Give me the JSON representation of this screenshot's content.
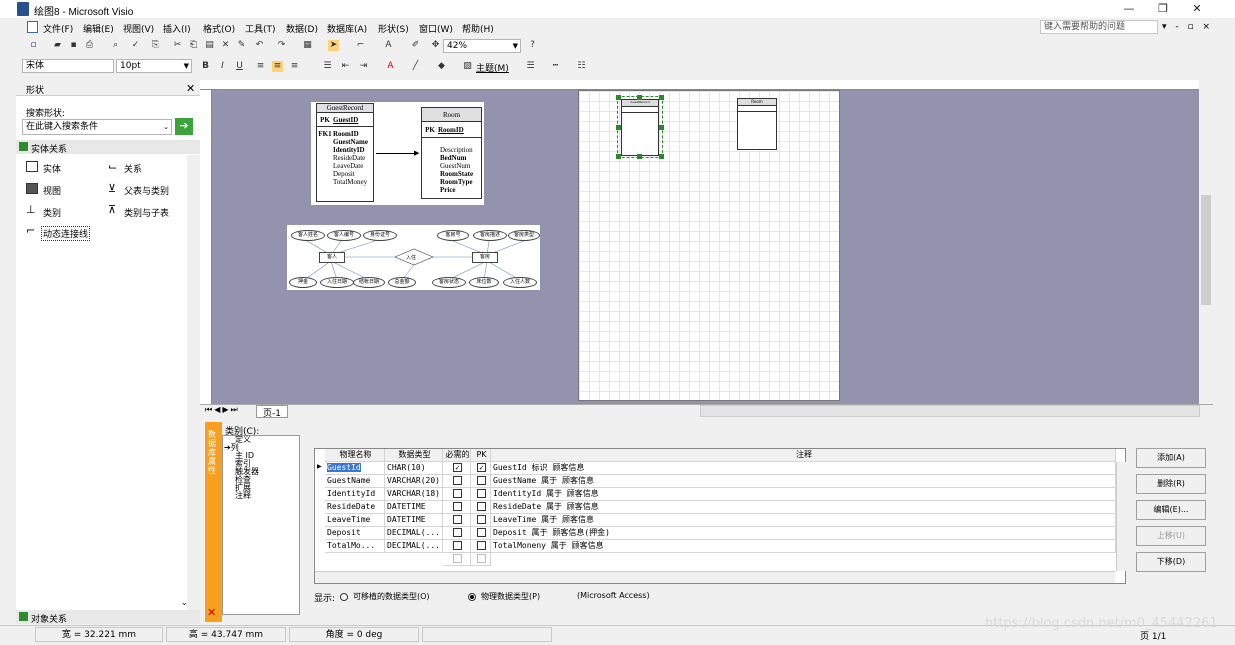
{
  "window": {
    "title": "绘图8 - Microsoft Visio",
    "minimize": "—",
    "restore": "❐",
    "close": "✕"
  },
  "menu": {
    "items": [
      "文件(F)",
      "编辑(E)",
      "视图(V)",
      "插入(I)",
      "格式(O)",
      "工具(T)",
      "数据(D)",
      "数据库(A)",
      "形状(S)",
      "窗口(W)",
      "帮助(H)"
    ],
    "help_placeholder": "键入需要帮助的问题",
    "doc_controls": "▾ - ▫ ×"
  },
  "toolbar": {
    "zoom": "42%",
    "font": "宋体",
    "size": "10pt",
    "theme": "主题(M)"
  },
  "shapes_pane": {
    "title": "形状",
    "search_label": "搜索形状:",
    "search_placeholder": "在此键入搜索条件",
    "stencil_entity": "实体关系",
    "stencil_object": "对象关系",
    "items": [
      {
        "label": "实体",
        "icon": "entity-icon"
      },
      {
        "label": "关系",
        "icon": "relationship-icon"
      },
      {
        "label": "视图",
        "icon": "view-icon"
      },
      {
        "label": "父表与类别",
        "icon": "parent-category-icon"
      },
      {
        "label": "类别",
        "icon": "category-icon"
      },
      {
        "label": "类别与子表",
        "icon": "category-child-icon"
      },
      {
        "label": "动态连接线",
        "icon": "dynamic-connector-icon"
      }
    ]
  },
  "diagram": {
    "guest": {
      "title": "GuestRecord",
      "pk_label": "PK",
      "pk": "GuestID",
      "fk_label": "FK1",
      "fields": [
        "RoomID",
        "GuestName",
        "IdentityID",
        "ResideDate",
        "LeaveDate",
        "Deposit",
        "TotalMoney"
      ]
    },
    "room": {
      "title": "Room",
      "pk_label": "PK",
      "pk": "RoomID",
      "fields": [
        "Description",
        "BedNum",
        "GuestNum",
        "RoomState",
        "RoomType",
        "Price"
      ]
    },
    "er": {
      "entity_guest": "客人",
      "entity_room": "客房",
      "relation": "入住",
      "attrs_top": [
        "客人姓名",
        "客人编号",
        "身份证号",
        "客房号",
        "客房描述",
        "客房类型"
      ],
      "attrs_bottom": [
        "押金",
        "入住日期",
        "结帐日期",
        "总金额",
        "客房状态",
        "床位数",
        "入住人数"
      ]
    },
    "mini_guest_title": "GuestRecord",
    "mini_room_title": "Room",
    "page_tab": "页-1"
  },
  "db_props": {
    "category_label": "类别(C):",
    "side_tab_text": "数据库属性",
    "categories": [
      "定义",
      "列",
      "主 ID",
      "索引",
      "触发器",
      "检查",
      "扩展",
      "注释"
    ],
    "headers": [
      "物理名称",
      "数据类型",
      "必需的",
      "PK",
      "注释"
    ],
    "rows": [
      {
        "name": "GuestId",
        "type": "CHAR(10)",
        "req": "✓",
        "pk": "✓",
        "note": "GuestId 标识 顾客信息"
      },
      {
        "name": "GuestName",
        "type": "VARCHAR(20)",
        "req": "",
        "pk": "",
        "note": "GuestName 属于 顾客信息"
      },
      {
        "name": "IdentityId",
        "type": "VARCHAR(18)",
        "req": "",
        "pk": "",
        "note": "IdentityId 属于 顾客信息"
      },
      {
        "name": "ResideDate",
        "type": "DATETIME",
        "req": "",
        "pk": "",
        "note": "ResideDate 属于 顾客信息"
      },
      {
        "name": "LeaveTime",
        "type": "DATETIME",
        "req": "",
        "pk": "",
        "note": "LeaveTime 属于 顾客信息"
      },
      {
        "name": "Deposit",
        "type": "DECIMAL(...",
        "req": "",
        "pk": "",
        "note": "Deposit 属于 顾客信息(押金)"
      },
      {
        "name": "TotalMo...",
        "type": "DECIMAL(...",
        "req": "",
        "pk": "",
        "note": "TotalMoneny 属于 顾客信息"
      }
    ],
    "buttons": [
      "添加(A)",
      "删除(R)",
      "编辑(E)...",
      "上移(U)",
      "下移(D)"
    ],
    "show_label": "显示:",
    "radio_portable": "可移植的数据类型(O)",
    "radio_physical": "物理数据类型(P)",
    "db_type": "(Microsoft Access)"
  },
  "status": {
    "width": "宽 = 32.221 mm",
    "height": "高 = 43.747 mm",
    "angle": "角度 = 0 deg",
    "page": "页 1/1",
    "watermark": "https://blog.csdn.net/m0_45442261"
  }
}
